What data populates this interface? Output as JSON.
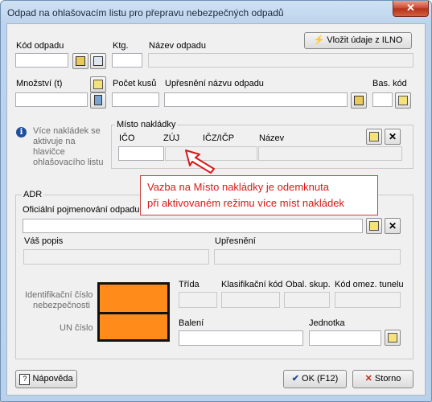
{
  "window": {
    "title": "Odpad na ohlašovacím listu pro přepravu nebezpečných odpadů",
    "close_glyph": "✕"
  },
  "top": {
    "kod_label": "Kód odpadu",
    "ktg_label": "Ktg.",
    "nazev_label": "Název odpadu",
    "ilno_button": "Vložit údaje z ILNO",
    "mnozstvi_label": "Množství (t)",
    "pocet_label": "Počet kusů",
    "upresneni_label": "Upřesnění názvu odpadu",
    "bas_label": "Bas. kód"
  },
  "info": {
    "text_lines": [
      "Více nakládek se",
      "aktivuje na",
      "hlavičce",
      "ohlašovacího listu"
    ]
  },
  "misto": {
    "title": "Místo nakládky",
    "cols": [
      "IČO",
      "ZÚJ",
      "IČZ/IČP",
      "Název"
    ]
  },
  "callout": {
    "lines": [
      "Vazba na Místo nakládky je odemknuta",
      "při aktivovaném režimu více míst nakládek"
    ]
  },
  "adr": {
    "title": "ADR",
    "ofic_label": "Oficiální pojmenování odpadu",
    "popis_label": "Váš popis",
    "upresneni_label": "Upřesnění",
    "ident_label_1": "Identifikační číslo",
    "ident_label_2": "nebezpečnosti",
    "un_label": "UN číslo",
    "trida_label": "Třída",
    "klas_label": "Klasifikační kód",
    "obal_label": "Obal. skup.",
    "kod_omez_label": "Kód omez. tunelu",
    "baleni_label": "Balení",
    "jednotka_label": "Jednotka"
  },
  "footer": {
    "help": "Nápověda",
    "ok": "OK (F12)",
    "cancel": "Storno"
  },
  "colors": {
    "orange_plate": "#ff8c1a",
    "callout": "#d81818"
  }
}
